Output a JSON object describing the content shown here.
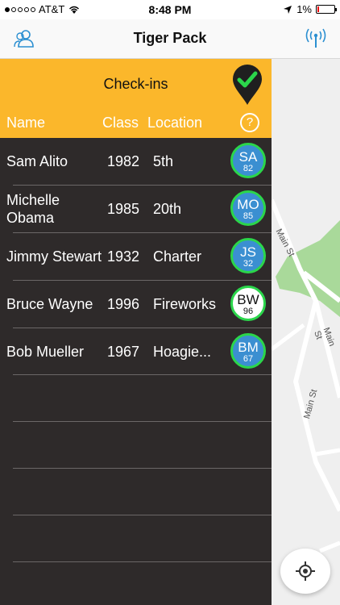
{
  "status_bar": {
    "carrier": "AT&T",
    "time": "8:48 PM",
    "battery_percent": "1%",
    "signal_icon": "signal-dots-icon",
    "wifi_icon": "wifi-icon",
    "location_icon": "location-arrow-icon",
    "battery_icon": "battery-icon"
  },
  "nav": {
    "title": "Tiger Pack",
    "left_icon": "users-icon",
    "right_icon": "antenna-icon",
    "accent_color": "#2b8fd1"
  },
  "checkins": {
    "title": "Check-ins",
    "header_color": "#fbb72b",
    "pin_icon": "checkmark-pin-icon",
    "help_icon": "question-circle-icon",
    "columns": {
      "name": "Name",
      "class": "Class",
      "location": "Location"
    },
    "rows": [
      {
        "name": "Sam Alito",
        "class": "1982",
        "location": "5th",
        "initials": "SA",
        "number": "82",
        "badge_style": "blue"
      },
      {
        "name": "Michelle Obama",
        "class": "1985",
        "location": "20th",
        "initials": "MO",
        "number": "85",
        "badge_style": "blue"
      },
      {
        "name": "Jimmy Stewart",
        "class": "1932",
        "location": "Charter",
        "initials": "JS",
        "number": "32",
        "badge_style": "blue"
      },
      {
        "name": "Bruce Wayne",
        "class": "1996",
        "location": "Fireworks",
        "initials": "BW",
        "number": "96",
        "badge_style": "white"
      },
      {
        "name": "Bob Mueller",
        "class": "1967",
        "location": "Hoagie...",
        "initials": "BM",
        "number": "67",
        "badge_style": "blue"
      }
    ]
  },
  "map": {
    "street_labels": [
      "Main St",
      "Main St",
      "Main St"
    ],
    "locate_icon": "crosshair-locate-icon"
  }
}
